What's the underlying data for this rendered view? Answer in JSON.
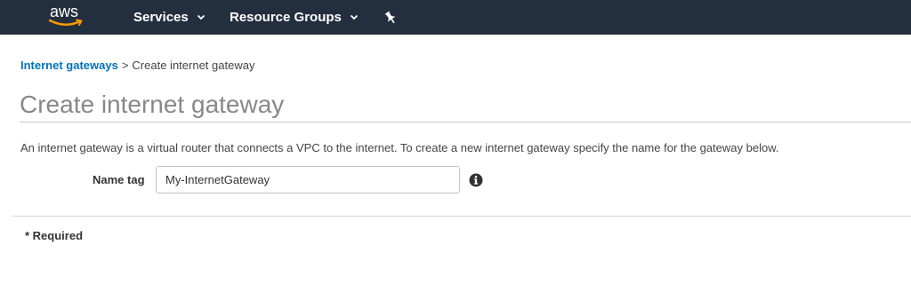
{
  "navbar": {
    "logo_text": "aws",
    "services_label": "Services",
    "resource_groups_label": "Resource Groups",
    "pin_icon": "pin-icon",
    "background_color": "#232f3e",
    "logo_smile_color": "#ff9900"
  },
  "breadcrumb": {
    "parent_label": "Internet gateways",
    "separator": ">",
    "current_label": "Create internet gateway"
  },
  "page": {
    "title": "Create internet gateway",
    "description": "An internet gateway is a virtual router that connects a VPC to the internet. To create a new internet gateway specify the name for the gateway below."
  },
  "form": {
    "name_tag_label": "Name tag",
    "name_tag_value": "My-InternetGateway",
    "info_icon": "info-icon"
  },
  "footer": {
    "required_note": "* Required"
  }
}
